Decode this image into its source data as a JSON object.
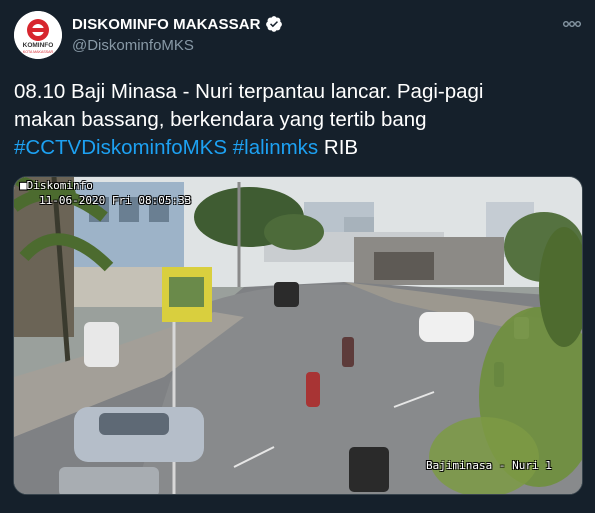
{
  "account": {
    "display_name": "DISKOMINFO MAKASSAR",
    "handle": "@DiskominfoMKS",
    "avatar_text": "KOMINFO",
    "avatar_subtext": "KOTA MAKASSAR"
  },
  "tweet": {
    "text_line1": "08.10 Baji Minasa - Nuri terpantau lancar. Pagi-pagi",
    "text_line2": "makan bassang, berkendara yang tertib bang",
    "hashtag1": "#CCTVDiskominfoMKS",
    "hashtag2": "#lalinmks",
    "text_end": "RIB"
  },
  "media": {
    "overlay_source": "■Diskominfo",
    "overlay_timestamp": "11-06-2020 Fri 08:05:33",
    "overlay_location": "Bajiminasa - Nuri 1"
  },
  "colors": {
    "background": "#15202b",
    "hashtag": "#1da1f2",
    "secondary_text": "#8899a6",
    "verified_badge": "#ffffff"
  },
  "icons": {
    "verified": "verified-badge-icon",
    "more": "more-options-icon"
  }
}
